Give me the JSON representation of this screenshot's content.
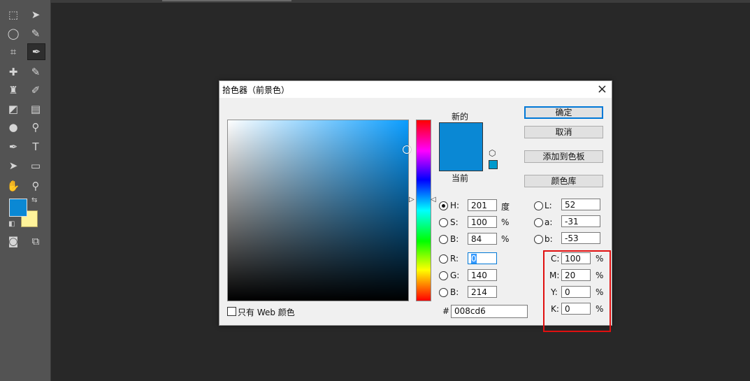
{
  "toolbar": {
    "tools": [
      "marquee-tool",
      "move-tool",
      "lasso-tool",
      "quick-select-tool",
      "crop-tool",
      "eyedropper-tool",
      "healing-brush-tool",
      "brush-tool",
      "clone-stamp-tool",
      "history-brush-tool",
      "eraser-tool",
      "gradient-tool",
      "blur-tool",
      "dodge-tool",
      "pen-tool",
      "type-tool",
      "path-select-tool",
      "shape-tool",
      "hand-tool",
      "zoom-tool"
    ],
    "type_glyph": "T",
    "foreground_color": "#0a88d4",
    "background_color": "#fff39a"
  },
  "dialog": {
    "title": "拾色器（前景色）",
    "close_glyph": "×",
    "new_label": "新的",
    "current_label": "当前",
    "new_color": "#0a88d4",
    "buttons": {
      "ok": "确定",
      "cancel": "取消",
      "add_swatch": "添加到色板",
      "color_libraries": "颜色库"
    },
    "hsb": {
      "h_label": "H:",
      "h_value": "201",
      "h_unit": "度",
      "s_label": "S:",
      "s_value": "100",
      "s_unit": "%",
      "b_label": "B:",
      "b_value": "84",
      "b_unit": "%"
    },
    "rgb": {
      "r_label": "R:",
      "r_value": "0",
      "g_label": "G:",
      "g_value": "140",
      "b_label": "B:",
      "b_value": "214"
    },
    "lab": {
      "l_label": "L:",
      "l_value": "52",
      "a_label": "a:",
      "a_value": "-31",
      "b_label": "b:",
      "b_value": "-53"
    },
    "cmyk": {
      "c_label": "C:",
      "c_value": "100",
      "m_label": "M:",
      "m_value": "20",
      "y_label": "Y:",
      "y_value": "0",
      "k_label": "K:",
      "k_value": "0",
      "unit": "%"
    },
    "hex_prefix": "#",
    "hex_value": "008cd6",
    "web_only_label": "只有 Web 颜色",
    "highlight_color": "#e01010"
  }
}
